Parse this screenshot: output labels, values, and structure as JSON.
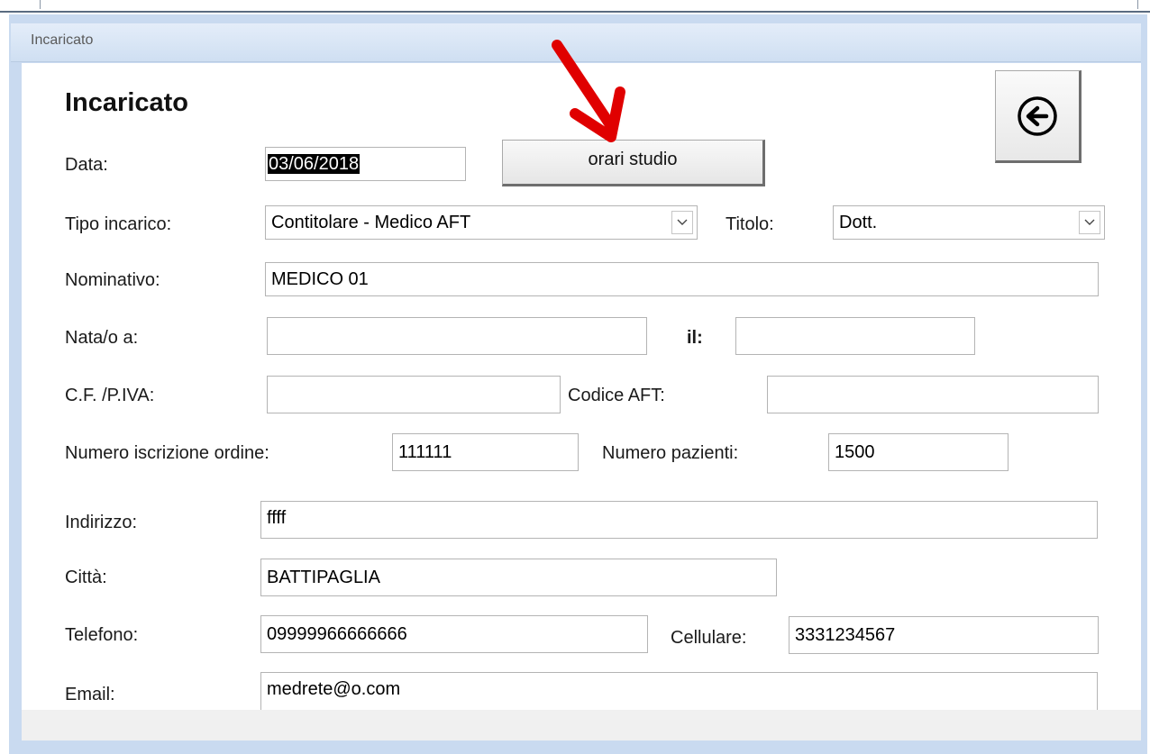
{
  "window": {
    "title": "Incaricato"
  },
  "form": {
    "heading": "Incaricato",
    "data": {
      "label": "Data:",
      "value": "03/06/2018"
    },
    "orari_button": "orari studio",
    "tipo_incarico": {
      "label": "Tipo incarico:",
      "value": "Contitolare - Medico AFT"
    },
    "titolo": {
      "label": "Titolo:",
      "value": "Dott."
    },
    "nominativo": {
      "label": "Nominativo:",
      "value": "MEDICO 01"
    },
    "nata_a": {
      "label": "Nata/o a:",
      "value": ""
    },
    "il": {
      "label": "il:",
      "value": ""
    },
    "cf_piva": {
      "label": "C.F. /P.IVA:",
      "value": ""
    },
    "codice_aft": {
      "label": "Codice AFT:",
      "value": ""
    },
    "numero_iscrizione": {
      "label": "Numero iscrizione ordine:",
      "value": "111111"
    },
    "numero_pazienti": {
      "label": "Numero pazienti:",
      "value": "1500"
    },
    "indirizzo": {
      "label": "Indirizzo:",
      "value": "ffff"
    },
    "citta": {
      "label": "Città:",
      "value": "BATTIPAGLIA"
    },
    "telefono": {
      "label": "Telefono:",
      "value": "09999966666666"
    },
    "cellulare": {
      "label": "Cellulare:",
      "value": "3331234567"
    },
    "email": {
      "label": "Email:",
      "value": "medrete@o.com"
    }
  },
  "icons": {
    "back": "back-arrow-icon",
    "annotation": "red-arrow-annotation",
    "dropdown": "chevron-down-icon"
  },
  "colors": {
    "annotation": "#e00000",
    "titlebar": "#cfdff2",
    "frame": "#c9daf0"
  }
}
